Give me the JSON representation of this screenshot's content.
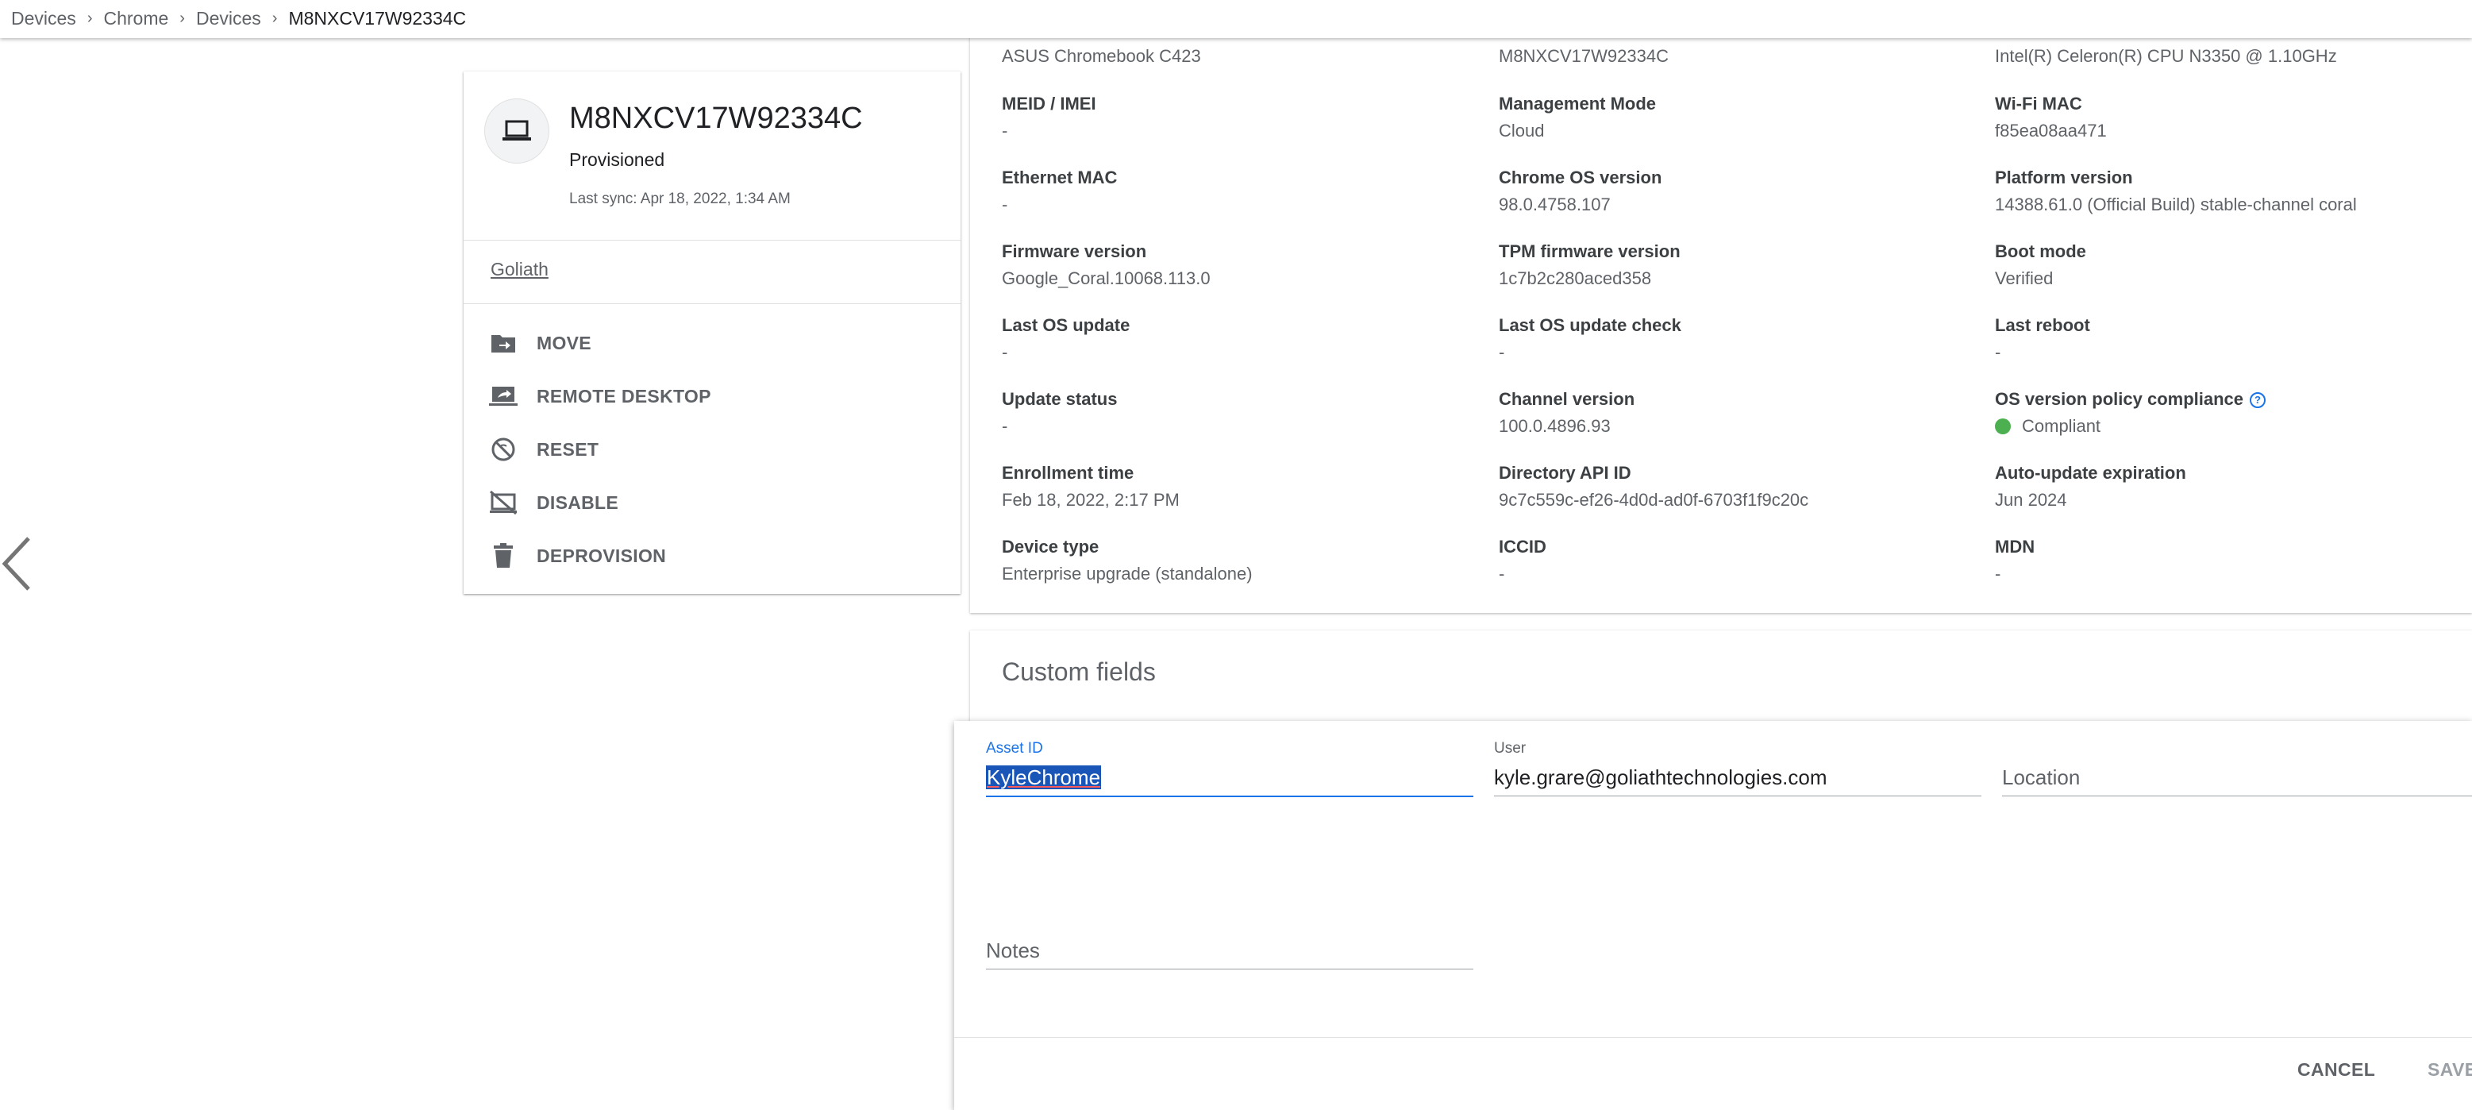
{
  "breadcrumb": [
    "Devices",
    "Chrome",
    "Devices",
    "M8NXCV17W92334C"
  ],
  "device": {
    "serial": "M8NXCV17W92334C",
    "status": "Provisioned",
    "last_sync": "Last sync: Apr 18, 2022, 1:34 AM",
    "org_unit": "Goliath",
    "avatar_icon": "laptop-icon"
  },
  "actions": [
    {
      "label": "MOVE",
      "icon": "move-folder-icon"
    },
    {
      "label": "REMOTE DESKTOP",
      "icon": "remote-desktop-icon"
    },
    {
      "label": "RESET",
      "icon": "reset-icon"
    },
    {
      "label": "DISABLE",
      "icon": "disable-icon"
    },
    {
      "label": "DEPROVISION",
      "icon": "trash-icon"
    }
  ],
  "top_values": [
    "ASUS Chromebook C423",
    "M8NXCV17W92334C",
    "Intel(R) Celeron(R) CPU N3350 @ 1.10GHz"
  ],
  "info_fields": [
    {
      "label": "MEID / IMEI",
      "value": "-"
    },
    {
      "label": "Management Mode",
      "value": "Cloud"
    },
    {
      "label": "Wi-Fi MAC",
      "value": "f85ea08aa471"
    },
    {
      "label": "Ethernet MAC",
      "value": "-"
    },
    {
      "label": "Chrome OS version",
      "value": "98.0.4758.107"
    },
    {
      "label": "Platform version",
      "value": "14388.61.0 (Official Build) stable-channel coral"
    },
    {
      "label": "Firmware version",
      "value": "Google_Coral.10068.113.0"
    },
    {
      "label": "TPM firmware version",
      "value": "1c7b2c280aced358"
    },
    {
      "label": "Boot mode",
      "value": "Verified"
    },
    {
      "label": "Last OS update",
      "value": "-"
    },
    {
      "label": "Last OS update check",
      "value": "-"
    },
    {
      "label": "Last reboot",
      "value": "-"
    },
    {
      "label": "Update status",
      "value": "-"
    },
    {
      "label": "Channel version",
      "value": "100.0.4896.93"
    },
    {
      "label": "OS version policy compliance",
      "value": "Compliant"
    },
    {
      "label": "Enrollment time",
      "value": "Feb 18, 2022, 2:17 PM"
    },
    {
      "label": "Directory API ID",
      "value": "9c7c559c-ef26-4d0d-ad0f-6703f1f9c20c"
    },
    {
      "label": "Auto-update expiration",
      "value": "Jun 2024"
    },
    {
      "label": "Device type",
      "value": "Enterprise upgrade (standalone)"
    },
    {
      "label": "ICCID",
      "value": "-"
    },
    {
      "label": "MDN",
      "value": "-"
    }
  ],
  "compliance_color": "#4caf50",
  "custom_fields": {
    "title": "Custom fields",
    "asset_id": {
      "label": "Asset ID",
      "value": "KyleChrome"
    },
    "user": {
      "label": "User",
      "value": "kyle.grare@goliathtechnologies.com"
    },
    "location": {
      "placeholder": "Location"
    },
    "notes": {
      "placeholder": "Notes"
    },
    "cancel_label": "CANCEL",
    "save_label": "SAVE"
  },
  "accent_color": "#1a73e8"
}
